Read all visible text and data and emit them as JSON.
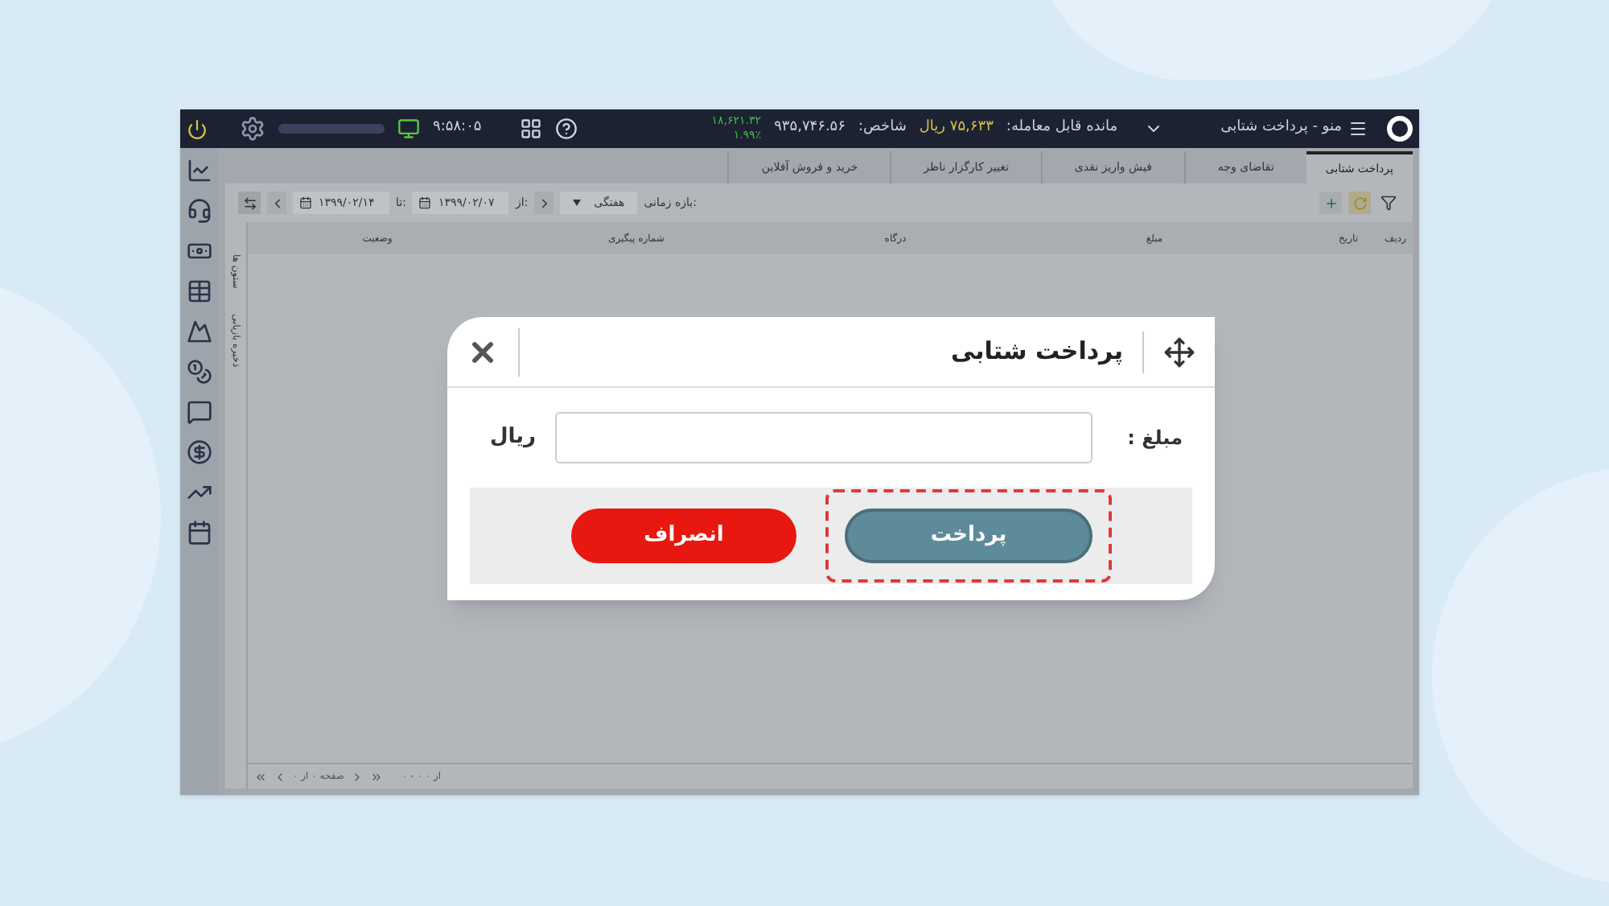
{
  "topbar": {
    "menu_label": "منو - پرداخت شتابی",
    "balance_label": "مانده قابل معامله:",
    "balance_value": "۷۵,۶۳۳ ریال",
    "index_label": "شاخص:",
    "index_value": "۹۳۵,۷۴۶.۵۶",
    "index_change": "۱۸,۶۲۱.۳۲",
    "index_percent": "۱.۹۹٪",
    "clock": "۹:۵۸:۰۵"
  },
  "tabs": [
    {
      "label": "پرداخت شتابی",
      "selected": true
    },
    {
      "label": "تقاضای وجه",
      "selected": false
    },
    {
      "label": "فیش واریز نقدی",
      "selected": false
    },
    {
      "label": "تغییر کارگزار ناظر",
      "selected": false
    },
    {
      "label": "خرید و فروش آفلاین",
      "selected": false
    }
  ],
  "filter": {
    "range_label": "بازه زمانی:",
    "period": "هفتگی",
    "from_label": "از:",
    "from_date": "۱۳۹۹/۰۲/۰۷",
    "to_label": "تا:",
    "to_date": "۱۳۹۹/۰۲/۱۴"
  },
  "table": {
    "columns": [
      "ردیف",
      "تاریخ",
      "مبلغ",
      "درگاه",
      "شماره پیگیری",
      "وضعیت"
    ]
  },
  "side_tabs": [
    "ستون ها",
    "ذخیره بازیابی"
  ],
  "pagination": {
    "page_text": "صفحه ۰ از ۰",
    "range_text": "۰ - ۰ از ۰"
  },
  "dialog": {
    "title": "پرداخت شتابی",
    "amount_label": "مبلغ :",
    "currency": "ریال",
    "buttons": [
      {
        "label": "پرداخت",
        "kind": "primary",
        "highlighted": true
      },
      {
        "label": "انصراف",
        "kind": "danger",
        "highlighted": false
      }
    ]
  }
}
